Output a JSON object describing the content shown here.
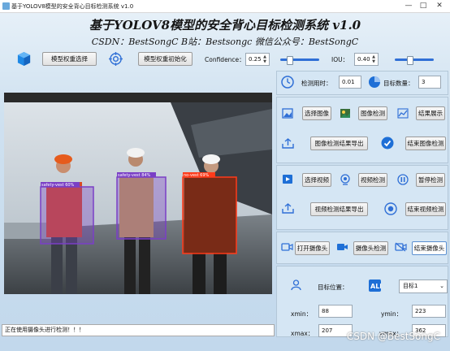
{
  "window": {
    "title": "基于YOLOV8模型的安全背心目标检测系统 v1.0",
    "controls": [
      "—",
      "□",
      "✕"
    ]
  },
  "header": {
    "title": "基于YOLOV8模型的安全背心目标检测系统 v1.0",
    "subtitle": "CSDN：BestSongC   B站：Bestsongc   微信公众号：BestSongC"
  },
  "toolbar": {
    "model_select_label": "模型权重选择",
    "model_init_label": "模型权重初始化",
    "confidence_label": "Confidence：",
    "confidence_value": "0.25",
    "confidence_level": 0.25,
    "iou_label": "IOU：",
    "iou_value": "0.40",
    "iou_level": 0.4
  },
  "stats": {
    "time_label": "检测用时：",
    "time_value": "0.01",
    "count_label": "目标数量：",
    "count_value": "3"
  },
  "image_section": {
    "select_label": "选择图像",
    "detect_label": "图像检测",
    "show_label": "结果展示",
    "export_label": "图像检测结果导出",
    "end_label": "结束图像检测"
  },
  "video_section": {
    "select_label": "选择视频",
    "detect_label": "视频检测",
    "pause_label": "暂停检测",
    "export_label": "视频检测结果导出",
    "end_label": "结束视频检测"
  },
  "camera_section": {
    "open_label": "打开摄像头",
    "detect_label": "摄像头检测",
    "end_label": "结束摄像头"
  },
  "target": {
    "position_label": "目标位置：",
    "select_value": "目标1",
    "xmin_label": "xmin：",
    "xmin_value": "88",
    "ymin_label": "ymin：",
    "ymin_value": "223",
    "xmax_label": "xmax：",
    "xmax_value": "207",
    "ymax_label": "ymax：",
    "ymax_value": "362"
  },
  "detections": [
    {
      "label": "safety-vest 60%"
    },
    {
      "label": "safety-vest 84%"
    },
    {
      "label": "no-vest 69%"
    }
  ],
  "status": {
    "message": "正在使用摄像头进行检测！！！"
  },
  "watermark": "CSDN @BestSongC",
  "colors": {
    "accent": "#2f6fd6",
    "box_vest_purple": "#7a3fc6",
    "box_novest_red": "#ff3b1a",
    "background": "#cfe3f3"
  }
}
